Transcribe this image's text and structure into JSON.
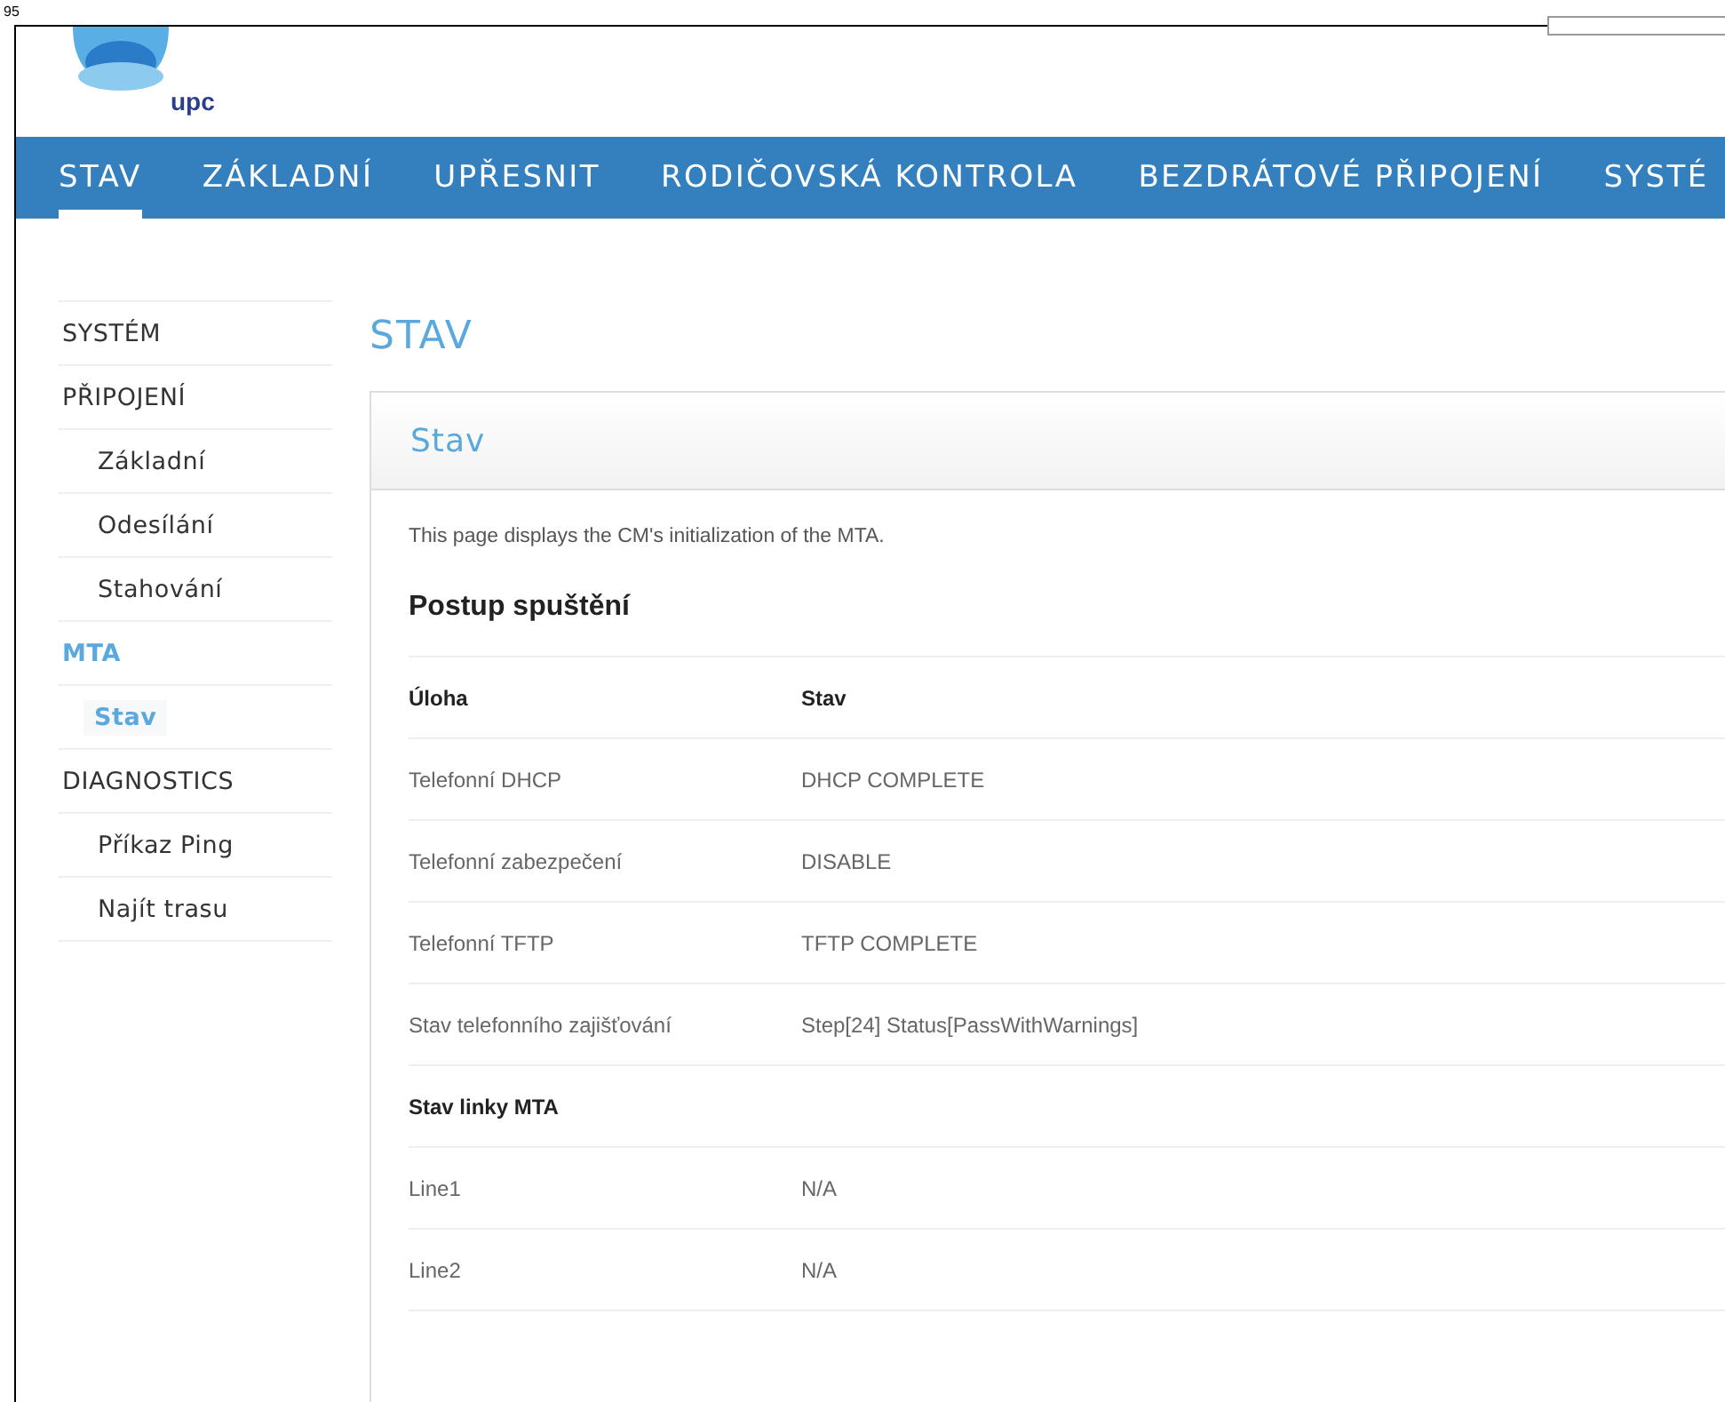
{
  "corner_label": "95",
  "logo": {
    "text": "upc"
  },
  "nav": [
    {
      "label": "STAV",
      "selected": true
    },
    {
      "label": "ZÁKLADNÍ",
      "selected": false
    },
    {
      "label": "UPŘESNIT",
      "selected": false
    },
    {
      "label": "RODIČOVSKÁ KONTROLA",
      "selected": false
    },
    {
      "label": "BEZDRÁTOVÉ PŘIPOJENÍ",
      "selected": false
    },
    {
      "label": "SYSTÉ",
      "selected": false
    }
  ],
  "sidebar": {
    "items": [
      {
        "label": "SYSTÉM",
        "selected": false
      },
      {
        "label": "PŘIPOJENÍ",
        "selected": false,
        "children": [
          {
            "label": "Základní",
            "selected": false
          },
          {
            "label": "Odesílání",
            "selected": false
          },
          {
            "label": "Stahování",
            "selected": false
          }
        ]
      },
      {
        "label": "MTA",
        "selected": true,
        "children": [
          {
            "label": "Stav",
            "selected": true
          }
        ]
      },
      {
        "label": "DIAGNOSTICS",
        "selected": false,
        "children": [
          {
            "label": "Příkaz Ping",
            "selected": false
          },
          {
            "label": "Najít trasu",
            "selected": false
          }
        ]
      }
    ]
  },
  "page_title": "STAV",
  "panel": {
    "title": "Stav",
    "description": "This page displays the CM's initialization of the MTA.",
    "section_title": "Postup spuštění",
    "table": {
      "rows": [
        {
          "kind": "header",
          "cells": [
            "Úloha",
            "Stav"
          ]
        },
        {
          "kind": "row",
          "cells": [
            "Telefonní DHCP",
            "DHCP COMPLETE"
          ]
        },
        {
          "kind": "row",
          "cells": [
            "Telefonní zabezpečení",
            "DISABLE"
          ]
        },
        {
          "kind": "row",
          "cells": [
            "Telefonní TFTP",
            "TFTP COMPLETE"
          ]
        },
        {
          "kind": "row",
          "cells": [
            "Stav telefonního zajišťování",
            "Step[24] Status[PassWithWarnings]"
          ]
        },
        {
          "kind": "section",
          "cells": [
            "Stav linky MTA"
          ]
        },
        {
          "kind": "row",
          "cells": [
            "Line1",
            "N/A"
          ]
        },
        {
          "kind": "row",
          "cells": [
            "Line2",
            "N/A"
          ]
        }
      ]
    }
  }
}
